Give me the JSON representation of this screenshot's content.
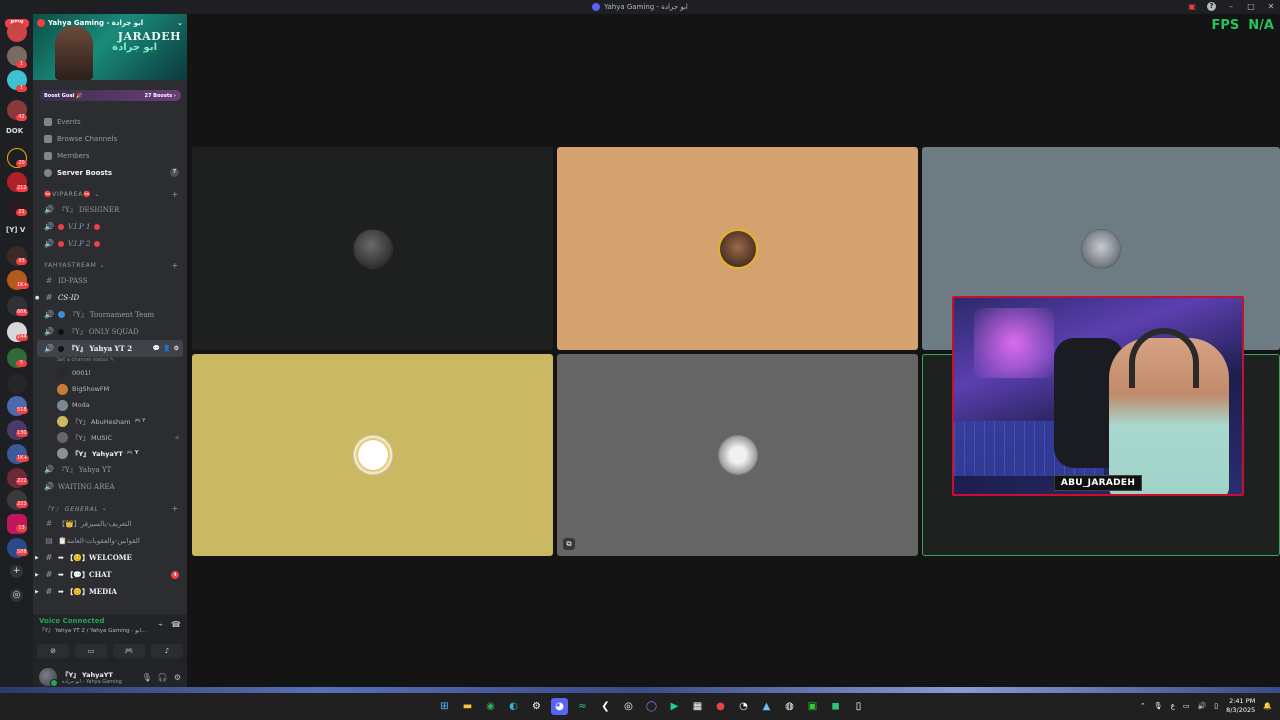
{
  "window": {
    "title": "Yahya Gaming - ابو جرادة"
  },
  "rail": {
    "new_label": "NEW",
    "dok_label": "DOK",
    "yv_label": "[Y] V",
    "badges": [
      "1",
      "1",
      "1",
      "42",
      "20",
      "212",
      "21",
      "93",
      "1K+",
      "60",
      "66K",
      "244",
      "5",
      "518",
      "130",
      "1K+",
      "222",
      "222",
      "13",
      "588"
    ]
  },
  "server": {
    "name": "Yahya Gaming - ابو جرادة",
    "banner_brand": "JARADEH",
    "banner_arabic": "ابو جرادة",
    "boost_goal": "Boost Goal 🎉",
    "boost_count": "27 Boosts ›"
  },
  "menu": [
    {
      "label": "Events"
    },
    {
      "label": "Browse Channels"
    },
    {
      "label": "Members"
    },
    {
      "label": "Server Boosts",
      "count": "7"
    }
  ],
  "categories": {
    "viparea": "⛔VIPAREA⛔",
    "yahyastream": "YAHYASTREAM",
    "general": "『Y』 GENERAL"
  },
  "channels": {
    "designer": "『Y』 DESIGNER",
    "vip1": "V.I.P 1",
    "vip2": "V.I.P 2",
    "idpass": "ID-PASS",
    "csid": "CS-ID",
    "tournament": "『Y』 Tournament Team",
    "onlysquad": "『Y』 ONLY SQUAD",
    "yahyayt2": "『Y』 Yahya YT 2",
    "set_status": "Set a channel status ✎",
    "yahyayt": "『Y』 Yahya YT",
    "waiting": "WAITING AREA",
    "intro": "【👑】التعريف-بالسيرفر",
    "rules": "📋القوانين-والعقوبات-العامة",
    "welcome": "➡ 【😊】WELCOME",
    "chat": "➡ 【💬】CHAT",
    "chat_mentions": "4",
    "media": "➡ 【😊】MEDIA"
  },
  "voice_users": [
    {
      "name": "0001l",
      "bold": false
    },
    {
      "name": "BigShowFM",
      "bold": false
    },
    {
      "name": "Moda",
      "bold": false
    },
    {
      "name": "『Y』 AbuHesham",
      "bold": false,
      "tag": "🎮 Y"
    },
    {
      "name": "『Y』 MUSIC",
      "bold": false,
      "right": "⌀"
    },
    {
      "name": "『Y』 YahyaYT",
      "bold": true,
      "tag": "🎮 Y"
    }
  ],
  "voice_panel": {
    "status": "Voice Connected",
    "location": "『Y』 Yahya YT 2 / Yahya Gaming - ابو..."
  },
  "user": {
    "name": "『Y』 YahyaYT",
    "status": "ابو جرادة - Yahya Gaming"
  },
  "overlay": {
    "fps_label": "FPS",
    "fps_value": "N/A"
  },
  "stream": {
    "name_tag": "ABU_JARADEH"
  },
  "colors": {
    "tile_dark": "#1e1f1f",
    "tile_orange": "#d4a26e",
    "tile_slate": "#6d7b82",
    "tile_gold": "#cbb862",
    "tile_gray": "#656565",
    "tile_black": "#1f2120",
    "speaking_green": "#3ba55c",
    "stream_border": "#c8102e"
  },
  "taskbar": {
    "time": "2:41 PM",
    "date": "8/3/2025"
  }
}
